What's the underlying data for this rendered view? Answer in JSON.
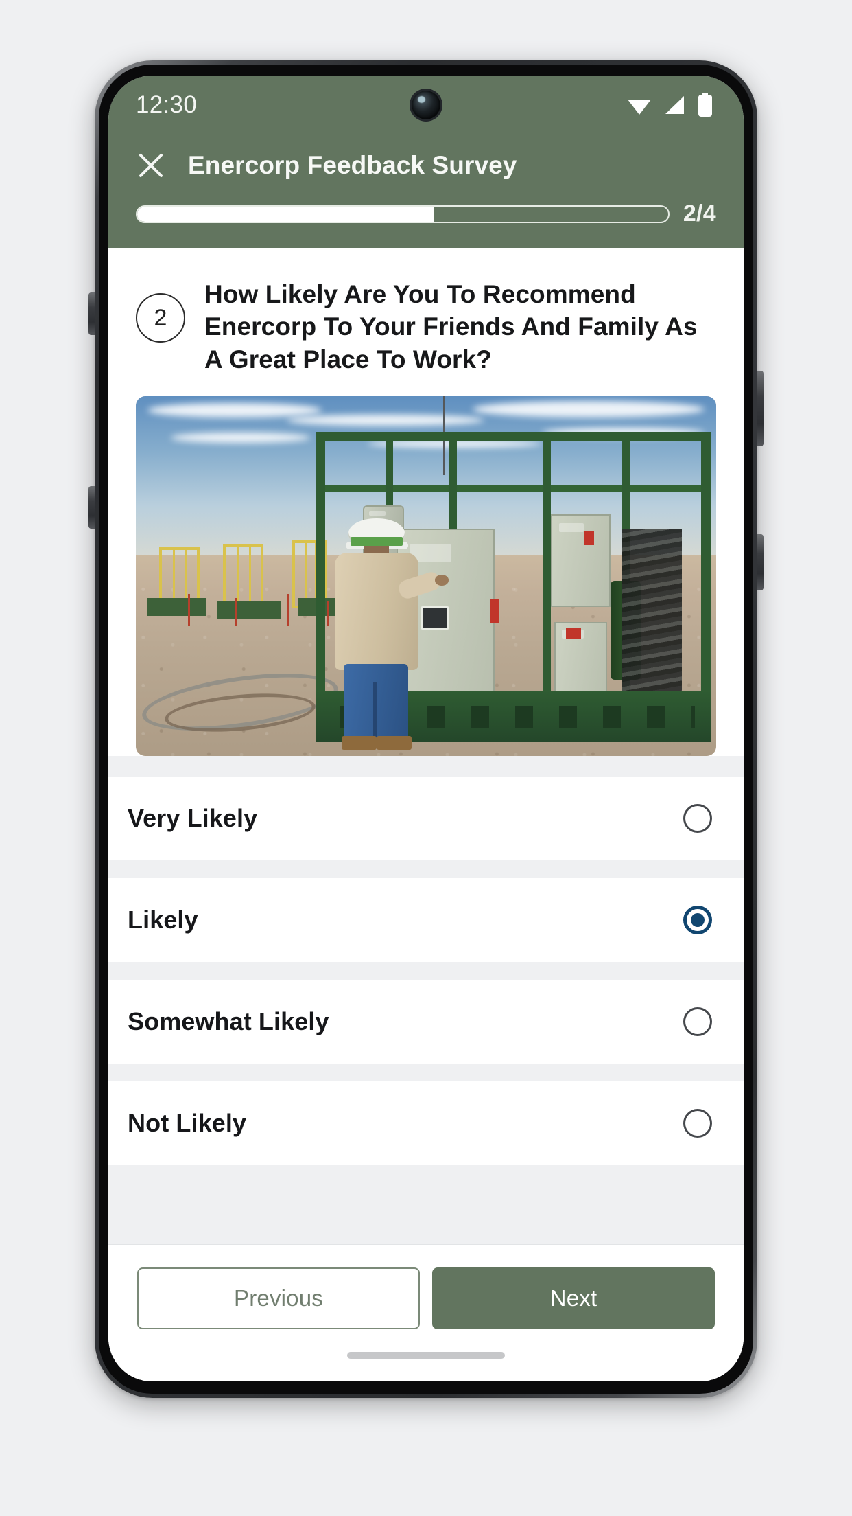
{
  "theme": {
    "brand_green": "#62755F",
    "page_background": "#EFF0F2",
    "card_background": "#FFFFFF",
    "radio_selected": "#114670",
    "text_primary": "#16171A",
    "prev_button_text": "#717E6F"
  },
  "status_bar": {
    "clock": "12:30",
    "icons": [
      "wifi-icon",
      "cellular-signal-icon",
      "battery-icon"
    ],
    "camera": "front-camera-punch-hole"
  },
  "app_bar": {
    "close_icon": "close-icon",
    "title": "Enercorp Feedback Survey"
  },
  "progress": {
    "label": "2/4",
    "current_step": 2,
    "total_steps": 4,
    "percent": 56
  },
  "question": {
    "number": "2",
    "text": "How Likely Are You To Recommend Enercorp To Your Friends And Family As A Great Place To Work?",
    "media_alt": "Worker in hard hat operating a green equipment skid at an oil field site"
  },
  "options": [
    {
      "label": "Very Likely",
      "selected": false
    },
    {
      "label": "Likely",
      "selected": true
    },
    {
      "label": "Somewhat Likely",
      "selected": false
    },
    {
      "label": "Not Likely",
      "selected": false
    }
  ],
  "footer": {
    "previous_label": "Previous",
    "next_label": "Next"
  }
}
